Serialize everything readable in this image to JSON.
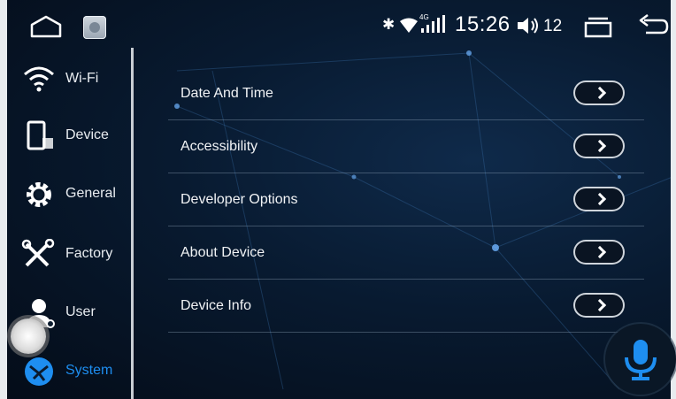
{
  "statusbar": {
    "bluetooth_glyph": "✱",
    "network_type": "4G",
    "time": "15:26",
    "volume": "12",
    "icons": [
      "home-icon",
      "app-icon",
      "bluetooth-icon",
      "wifi-icon",
      "signal-icon",
      "volume-icon",
      "recent-apps-icon",
      "back-icon"
    ]
  },
  "sidebar": {
    "items": [
      {
        "label": "Wi-Fi",
        "icon": "wifi-icon"
      },
      {
        "label": "Device",
        "icon": "device-icon"
      },
      {
        "label": "General",
        "icon": "gear-icon"
      },
      {
        "label": "Factory",
        "icon": "tools-icon"
      },
      {
        "label": "User",
        "icon": "user-icon"
      },
      {
        "label": "System",
        "icon": "system-icon",
        "active": true
      }
    ]
  },
  "list": {
    "items": [
      {
        "label": "Date And Time"
      },
      {
        "label": "Accessibility"
      },
      {
        "label": "Developer Options"
      },
      {
        "label": "About Device"
      },
      {
        "label": "Device Info"
      }
    ]
  },
  "colors": {
    "accent": "#1e8ef0",
    "background": "#081a30",
    "text": "#f1f3f5"
  }
}
